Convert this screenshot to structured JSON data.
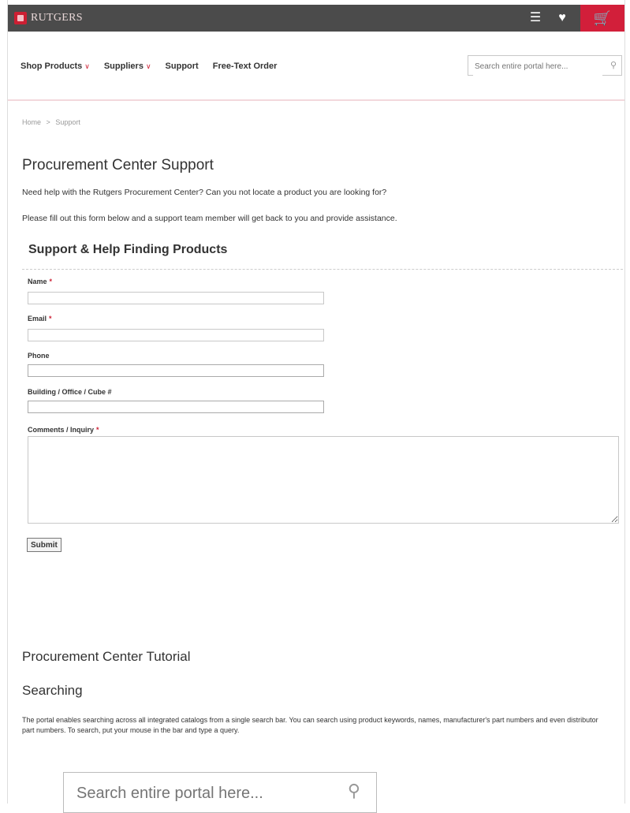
{
  "header": {
    "logo_text": "RUTGERS",
    "list_icon": "list-icon",
    "heart_icon": "heart-icon",
    "cart_icon": "cart-icon"
  },
  "nav": {
    "items": [
      {
        "label": "Shop Products",
        "has_dropdown": true
      },
      {
        "label": "Suppliers",
        "has_dropdown": true
      },
      {
        "label": "Support",
        "has_dropdown": false
      },
      {
        "label": "Free-Text Order",
        "has_dropdown": false
      }
    ],
    "search_placeholder": "Search entire portal here..."
  },
  "breadcrumb": {
    "home": "Home",
    "separator": ">",
    "current": "Support"
  },
  "page": {
    "title": "Procurement Center Support",
    "intro_1": "Need help with the Rutgers Procurement Center? Can you not locate a product you are looking for?",
    "intro_2": "Please fill out this form below and a support team member will get back to you and provide assistance."
  },
  "form": {
    "heading": "Support & Help Finding Products",
    "name_label": "Name",
    "email_label": "Email",
    "phone_label": "Phone",
    "building_label": "Building / Office / Cube #",
    "comments_label": "Comments / Inquiry",
    "required_mark": "*",
    "submit_label": "Submit"
  },
  "tutorial": {
    "title": "Procurement Center Tutorial",
    "searching_title": "Searching",
    "searching_text": "The portal enables searching across all integrated catalogs from a single search bar. You can search using product keywords, names, manufacturer's part numbers and even distributor part numbers. To search, put your mouse in the bar and type a query.",
    "search_placeholder": "Search entire portal here..."
  },
  "colors": {
    "brand_red": "#cc1f33",
    "cart_red": "#d21f3a",
    "topbar": "#4b4b4b"
  }
}
